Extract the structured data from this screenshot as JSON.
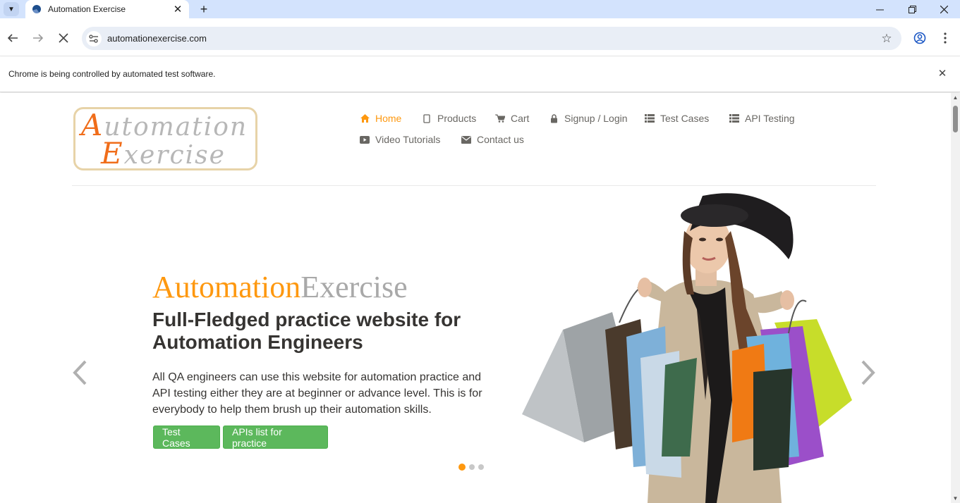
{
  "browser": {
    "tab_title": "Automation Exercise",
    "url": "automationexercise.com",
    "infobar_text": "Chrome is being controlled by automated test software."
  },
  "site": {
    "logo_line1_cap": "A",
    "logo_line1_rest": "utomation",
    "logo_line2_cap": "E",
    "logo_line2_rest": "xercise",
    "nav": [
      {
        "label": "Home",
        "icon": "home-icon"
      },
      {
        "label": "Products",
        "icon": "card-icon"
      },
      {
        "label": "Cart",
        "icon": "cart-icon"
      },
      {
        "label": "Signup / Login",
        "icon": "lock-icon"
      },
      {
        "label": "Test Cases",
        "icon": "list-icon"
      },
      {
        "label": "API Testing",
        "icon": "list-icon"
      },
      {
        "label": "Video Tutorials",
        "icon": "youtube-icon"
      },
      {
        "label": "Contact us",
        "icon": "envelope-icon"
      }
    ],
    "active_nav": "Home",
    "slider": {
      "title_part1": "Automation",
      "title_part2": "Exercise",
      "heading": "Full-Fledged practice website for Automation Engineers",
      "text": "All QA engineers can use this website for automation practice and API testing either they are at beginner or advance level. This is for everybody to help them brush up their automation skills.",
      "button1": "Test Cases",
      "button2": "APIs list for practice",
      "active_slide": 1,
      "slide_count": 3
    },
    "colors": {
      "accent": "#FE980F",
      "button_green": "#5CB85C",
      "text_dark": "#363432",
      "nav_text": "#696763"
    }
  }
}
